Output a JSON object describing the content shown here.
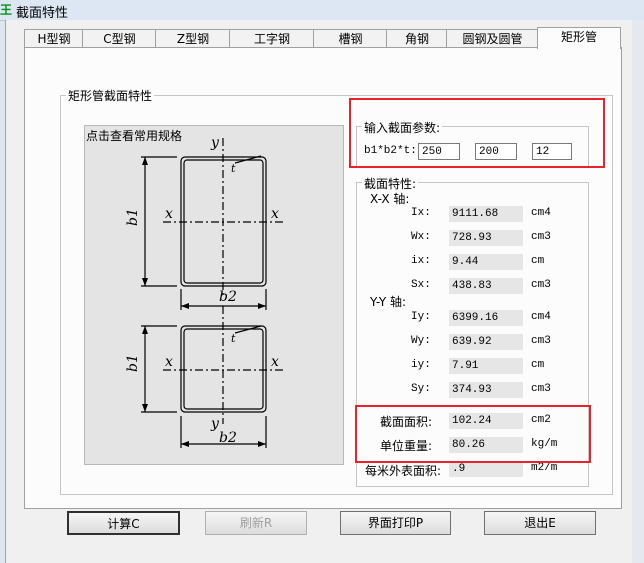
{
  "window": {
    "title": "截面特性",
    "icon": "app-icon"
  },
  "tabs": [
    "H型钢",
    "C型钢",
    "Z型钢",
    "工字钢",
    "槽钢",
    "角钢",
    "圆钢及圆管",
    "矩形管"
  ],
  "section": {
    "group_title": "矩形管截面特性",
    "figure_label": "点击查看常用规格",
    "diagram_labels": {
      "y": "y",
      "x": "x",
      "t": "t",
      "b1": "b1",
      "b2": "b2"
    }
  },
  "input": {
    "group_title": "输入截面参数:",
    "label": "b1*b2*t:",
    "values": [
      "250",
      "200",
      "12"
    ]
  },
  "properties": {
    "group_title": "截面特性:",
    "xx_title": "X-X 轴:",
    "yy_title": "Y-Y 轴:",
    "xx": [
      {
        "label": "Ix:",
        "value": "9111.68",
        "unit": "cm4"
      },
      {
        "label": "Wx:",
        "value": "728.93",
        "unit": "cm3"
      },
      {
        "label": "ix:",
        "value": "9.44",
        "unit": "cm"
      },
      {
        "label": "Sx:",
        "value": "438.83",
        "unit": "cm3"
      }
    ],
    "yy": [
      {
        "label": "Iy:",
        "value": "6399.16",
        "unit": "cm4"
      },
      {
        "label": "Wy:",
        "value": "639.92",
        "unit": "cm3"
      },
      {
        "label": "iy:",
        "value": "7.91",
        "unit": "cm"
      },
      {
        "label": "Sy:",
        "value": "374.93",
        "unit": "cm3"
      }
    ],
    "area": {
      "label": "截面面积:",
      "value": "102.24",
      "unit": "cm2"
    },
    "weight": {
      "label": "单位重量:",
      "value": "80.26",
      "unit": "kg/m"
    },
    "surface": {
      "label": "每米外表面积:",
      "value": ".9",
      "unit": "m2/m"
    }
  },
  "buttons": {
    "calc": "计算C",
    "refresh": "刷新R",
    "print": "界面打印P",
    "exit": "退出E"
  },
  "colors": {
    "highlight": "#e8232b"
  }
}
